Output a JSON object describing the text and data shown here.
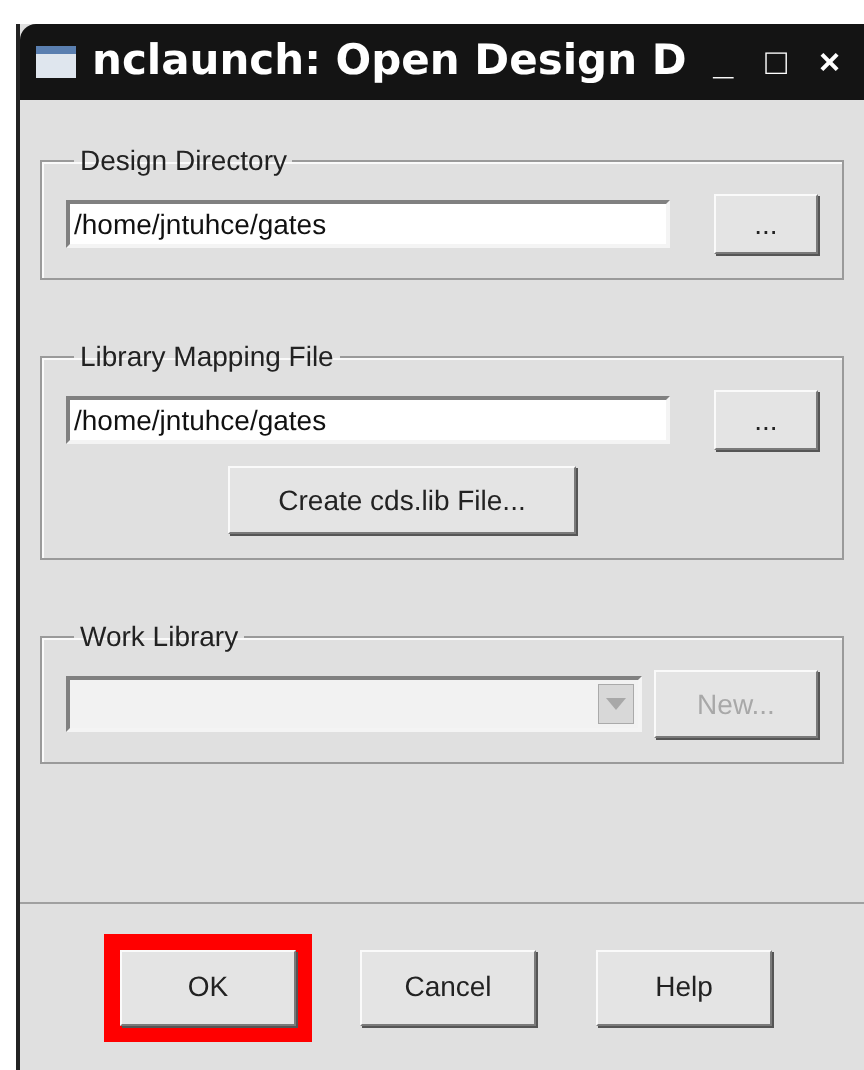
{
  "window": {
    "title": "nclaunch: Open Design D",
    "controls": [
      "_",
      "□",
      "×"
    ]
  },
  "groups": [
    {
      "kind": "path",
      "label": "Design Directory",
      "value": "/home/jntuhce/gates",
      "browse": "..."
    },
    {
      "kind": "path",
      "label": "Library Mapping File",
      "value": "/home/jntuhce/gates",
      "browse": "...",
      "action": "Create cds.lib File..."
    },
    {
      "kind": "library",
      "label": "Work Library",
      "disabled": true,
      "new_button": "New..."
    }
  ],
  "buttons": [
    {
      "label": "OK",
      "highlighted": true
    },
    {
      "label": "Cancel",
      "highlighted": false
    },
    {
      "label": "Help",
      "highlighted": false
    }
  ]
}
